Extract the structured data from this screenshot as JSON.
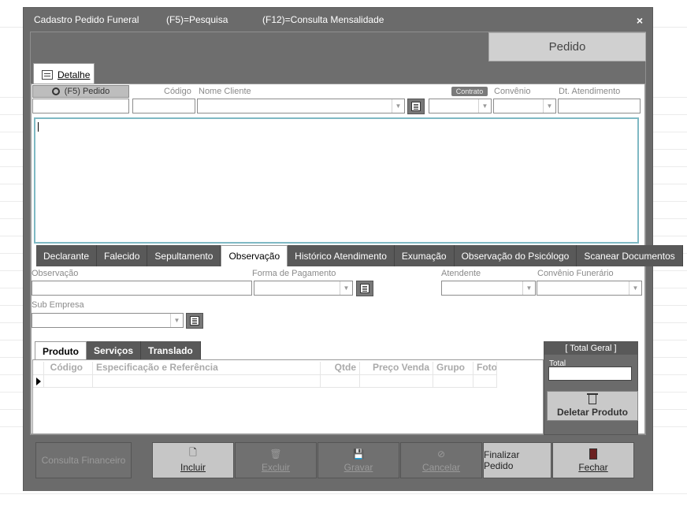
{
  "window": {
    "title": "Cadastro Pedido Funeral",
    "shortcut_f5": "(F5)=Pesquisa",
    "shortcut_f12": "(F12)=Consulta Mensalidade",
    "close": "×"
  },
  "header": {
    "badge": "Pedido"
  },
  "main_tab": {
    "label": "Detalhe",
    "icon": "document-icon"
  },
  "form_top": {
    "f5_pedido": "(F5) Pedido",
    "codigo_label": "Código",
    "nome_cliente_label": "Nome Cliente",
    "contrato": "Contrato",
    "convenio_label": "Convênio",
    "dt_atendimento_label": "Dt. Atendimento",
    "pedido_value": "",
    "codigo_value": "",
    "nome_cliente_value": "",
    "convenio_value": "",
    "dt_atendimento_value": ""
  },
  "sub_tabs": [
    "Declarante",
    "Falecido",
    "Sepultamento",
    "Observação",
    "Histórico Atendimento",
    "Exumação",
    "Observação do Psicólogo",
    "Scanear Documentos"
  ],
  "sub_tabs_active": 3,
  "obs_form": {
    "observacao_label": "Observação",
    "forma_pagamento_label": "Forma de Pagamento",
    "atendente_label": "Atendente",
    "convenio_funerario_label": "Convênio Funerário",
    "sub_empresa_label": "Sub Empresa"
  },
  "product_tabs": [
    "Produto",
    "Serviços",
    "Translado"
  ],
  "product_tabs_active": 0,
  "grid": {
    "columns": [
      "Código",
      "Especificação e Referência",
      "Qtde",
      "Preço Venda",
      "Grupo",
      "Foto"
    ]
  },
  "total": {
    "header": "[ Total Geral ]",
    "label": "Total",
    "value": "",
    "delete_label": "Deletar Produto"
  },
  "bottom": {
    "consulta": "Consulta Financeiro",
    "incluir": "Incluir",
    "excluir": "Excluir",
    "gravar": "Gravar",
    "cancelar": "Cancelar",
    "finalizar": "Finalizar Pedido",
    "fechar": "Fechar"
  }
}
